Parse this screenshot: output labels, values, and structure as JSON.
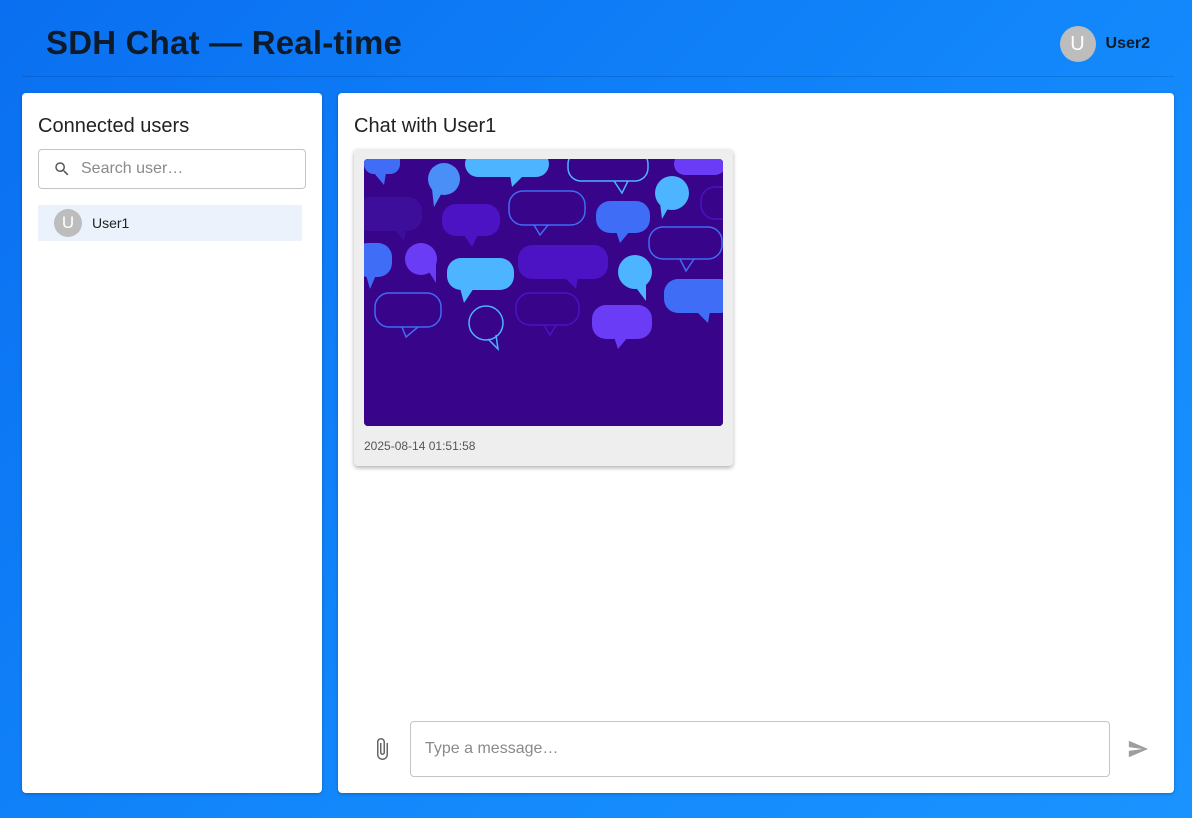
{
  "header": {
    "title": "SDH Chat — Real-time",
    "current_user": {
      "initial": "U",
      "name": "User2"
    }
  },
  "sidebar": {
    "title": "Connected users",
    "search": {
      "placeholder": "Search user…",
      "value": "",
      "icon": "search-icon"
    },
    "users": [
      {
        "initial": "U",
        "name": "User1",
        "selected": true
      }
    ]
  },
  "chat": {
    "title": "Chat with User1",
    "messages": [
      {
        "type": "image",
        "image_desc": "speech-bubbles-pattern",
        "timestamp": "2025-08-14 01:51:58"
      }
    ],
    "composer": {
      "placeholder": "Type a message…",
      "value": "",
      "attach_icon": "paperclip-icon",
      "send_icon": "send-icon"
    }
  },
  "colors": {
    "background": "#1287fb",
    "selected_row": "#ebf2fb",
    "image_bg": "#38048a"
  }
}
